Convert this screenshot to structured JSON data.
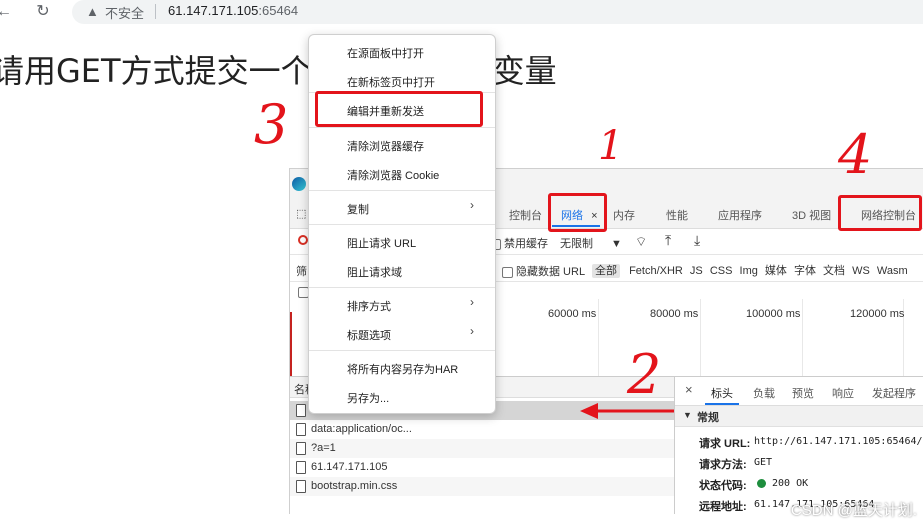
{
  "browser": {
    "back_icon": "back-arrow-icon",
    "reload_icon": "reload-icon",
    "warning_icon": "warning-triangle-icon",
    "insecure_label": "不安全",
    "host": "61.147.171.105",
    "port": ":65464"
  },
  "page": {
    "heading": "请用GET方式提交一个",
    "heading_tail": "的变量"
  },
  "context_menu": {
    "items": [
      {
        "label": "在源面板中打开"
      },
      {
        "label": "在新标签页中打开"
      },
      {
        "label": "编辑并重新发送"
      },
      {
        "label": "清除浏览器缓存"
      },
      {
        "label": "清除浏览器 Cookie"
      },
      {
        "label": "复制"
      },
      {
        "label": "阻止请求 URL"
      },
      {
        "label": "阻止请求域"
      },
      {
        "label": "排序方式"
      },
      {
        "label": "标题选项"
      },
      {
        "label": "将所有内容另存为HAR"
      },
      {
        "label": "另存为..."
      }
    ]
  },
  "devtools": {
    "tabs": [
      "控制台",
      "网络",
      "内存",
      "性能",
      "应用程序",
      "3D 视图",
      "网络控制台"
    ],
    "close_symbol": "×",
    "toolbar": {
      "disable_cache": "禁用缓存",
      "throttle": "无限制"
    },
    "filter": {
      "label_partial": "筛",
      "hide_data_urls": "隐藏数据 URL",
      "types": [
        "全部",
        "Fetch/XHR",
        "JS",
        "CSS",
        "Img",
        "媒体",
        "字体",
        "文档",
        "WS",
        "Wasm"
      ]
    },
    "timeline_ticks": [
      "60000 ms",
      "80000 ms",
      "100000 ms",
      "120000 ms"
    ],
    "requests_header": "名称",
    "requests": [
      {
        "name": "?a=1"
      },
      {
        "name": "data:application/oc..."
      },
      {
        "name": "?a=1"
      },
      {
        "name": "61.147.171.105"
      },
      {
        "name": "bootstrap.min.css"
      }
    ],
    "detail_tabs": [
      "标头",
      "负载",
      "预览",
      "响应",
      "发起程序"
    ],
    "detail_close": "×",
    "section": "常规",
    "general": {
      "url_key": "请求 URL:",
      "url_val": "http://61.147.171.105:65464/",
      "method_key": "请求方法:",
      "method_val": "GET",
      "status_key": "状态代码:",
      "status_val": "200 OK",
      "remote_key": "远程地址:",
      "remote_val": "61.147.171.105:65464"
    }
  },
  "annotations": [
    "1",
    "2",
    "3",
    "4"
  ],
  "watermark": "CSDN @蓝天计划.",
  "colors": {
    "annotation": "#e3141b",
    "status_ok": "#1e8e3e"
  }
}
